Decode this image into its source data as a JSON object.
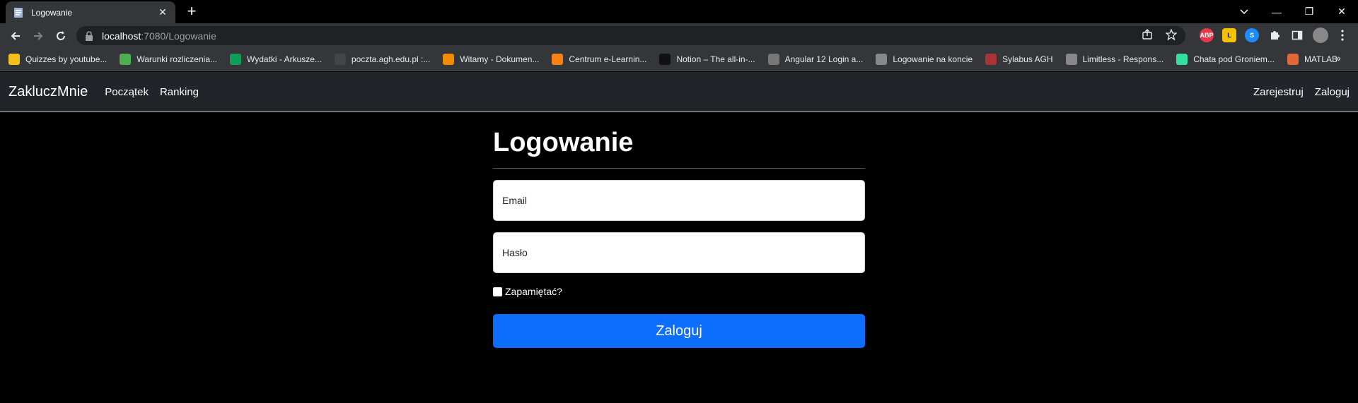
{
  "browser": {
    "tab": {
      "title": "Logowanie",
      "close": "✕"
    },
    "new_tab": "+",
    "window": {
      "minimize": "—",
      "restore": "❐",
      "close": "✕"
    },
    "address": {
      "host": "localhost",
      "rest": ":7080/Logowanie"
    },
    "extensions": [
      {
        "name": "adblock-plus-icon",
        "label": "ABP",
        "color": "#e8364a"
      },
      {
        "name": "extension-l-icon",
        "label": "L",
        "color": "#f3c300"
      },
      {
        "name": "shazam-icon",
        "label": "S",
        "color": "#1a8cff"
      }
    ]
  },
  "bookmarks": [
    {
      "label": "Quizzes by youtube...",
      "icon": "quiz-icon",
      "color": "#f2c21b"
    },
    {
      "label": "Warunki rozliczenia...",
      "icon": "e-icon",
      "color": "#4caf50"
    },
    {
      "label": "Wydatki - Arkusze...",
      "icon": "sheets-icon",
      "color": "#0f9d58"
    },
    {
      "label": "poczta.agh.edu.pl :...",
      "icon": "mail-icon",
      "color": "#444"
    },
    {
      "label": "Witamy - Dokumen...",
      "icon": "u-icon",
      "color": "#f28b00"
    },
    {
      "label": "Centrum e-Learnin...",
      "icon": "moodle-icon",
      "color": "#f98012"
    },
    {
      "label": "Notion – The all-in-...",
      "icon": "notion-icon",
      "color": "#111"
    },
    {
      "label": "Angular 12 Login a...",
      "icon": "page-icon",
      "color": "#777"
    },
    {
      "label": "Logowanie na koncie",
      "icon": "globe-icon",
      "color": "#888"
    },
    {
      "label": "Sylabus AGH",
      "icon": "agh-icon",
      "color": "#a33"
    },
    {
      "label": "Limitless - Respons...",
      "icon": "globe-icon",
      "color": "#888"
    },
    {
      "label": "Chata pod Groniem...",
      "icon": "tripadvisor-icon",
      "color": "#34e0a1"
    },
    {
      "label": "MATLAB",
      "icon": "matlab-icon",
      "color": "#e16737"
    }
  ],
  "site": {
    "brand": "ZakluczMnie",
    "nav_left": [
      "Początek",
      "Ranking"
    ],
    "nav_right": [
      "Zarejestruj",
      "Zaloguj"
    ]
  },
  "login": {
    "heading": "Logowanie",
    "email_placeholder": "Email",
    "password_placeholder": "Hasło",
    "remember_label": "Zapamiętać?",
    "submit_label": "Zaloguj"
  }
}
